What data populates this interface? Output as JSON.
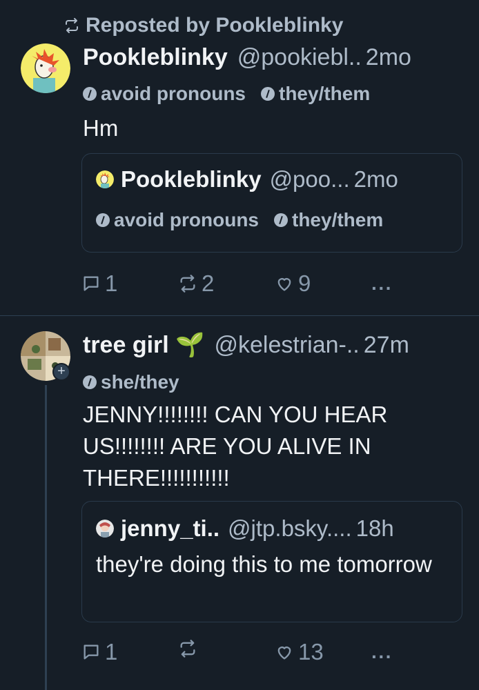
{
  "post1": {
    "repost_text": "Reposted by Pookleblinky",
    "author": {
      "name": "Pookleblinky",
      "handle": "@pookiebl..",
      "time": "2mo"
    },
    "labels": [
      "avoid pronouns",
      "they/them"
    ],
    "text": "Hm",
    "quote": {
      "author": {
        "name": "Pookleblinky",
        "handle": "@poo...",
        "time": "2mo"
      },
      "labels": [
        "avoid pronouns",
        "they/them"
      ]
    },
    "actions": {
      "replies": "1",
      "reposts": "2",
      "likes": "9",
      "more": "···"
    }
  },
  "post2": {
    "author": {
      "name": "tree girl 🌱",
      "handle": "@kelestrian-..",
      "time": "27m"
    },
    "labels": [
      "she/they"
    ],
    "text": "JENNY!!!!!!!! CAN YOU HEAR US!!!!!!!! ARE YOU ALIVE IN THERE!!!!!!!!!!!",
    "quote": {
      "author": {
        "name": "jenny_ti..",
        "handle": "@jtp.bsky....",
        "time": "18h"
      },
      "text": "they're doing this to me tomorrow"
    },
    "actions": {
      "replies": "1",
      "reposts": "",
      "likes": "13",
      "more": "···"
    }
  },
  "icons": {
    "repost": "repost-icon",
    "reply": "reply-icon",
    "like": "heart-icon",
    "more": "more-icon",
    "label": "info-icon",
    "follow": "plus-icon"
  },
  "colors": {
    "background": "#161e27",
    "text_primary": "#f1f3f5",
    "text_secondary": "#aebbc9",
    "border": "#2a3a4b"
  }
}
